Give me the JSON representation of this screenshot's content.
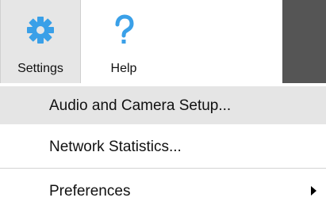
{
  "toolbar": {
    "settings": {
      "label": "Settings",
      "icon": "gear-icon",
      "icon_color": "#3aa0e8"
    },
    "help": {
      "label": "Help",
      "icon": "question-mark-icon",
      "icon_color": "#3aa0e8"
    }
  },
  "menu": {
    "items": [
      {
        "label": "Audio and Camera Setup...",
        "highlighted": true
      },
      {
        "label": "Network Statistics..."
      },
      {
        "label": "Preferences",
        "has_submenu": true,
        "submenu_icon": "submenu-arrow-icon"
      }
    ]
  },
  "colors": {
    "accent": "#3aa0e8",
    "highlight": "#e5e5e5",
    "dark_panel": "#555555"
  }
}
